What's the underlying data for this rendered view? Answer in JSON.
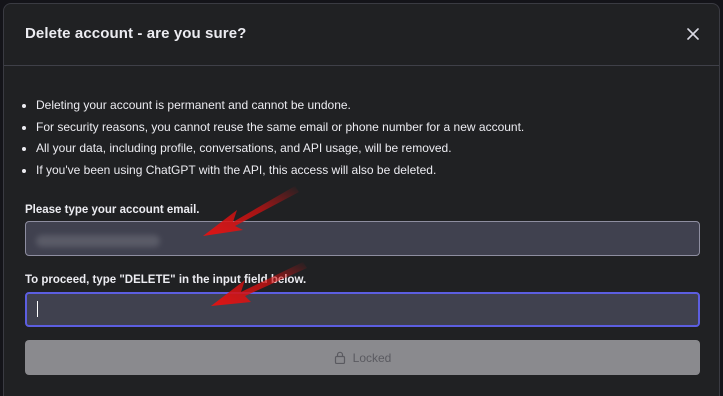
{
  "dialog": {
    "title": "Delete account - are you sure?",
    "close_icon": "close-icon"
  },
  "warnings": [
    "Deleting your account is permanent and cannot be undone.",
    "For security reasons, you cannot reuse the same email or phone number for a new account.",
    "All your data, including profile, conversations, and API usage, will be removed.",
    "If you've been using ChatGPT with the API, this access will also be deleted."
  ],
  "email_field": {
    "label": "Please type your account email.",
    "value": ""
  },
  "confirm_field": {
    "label": "To proceed, type \"DELETE\" in the input field below.",
    "value": ""
  },
  "locked_button": {
    "label": "Locked",
    "icon": "lock-icon"
  },
  "colors": {
    "background": "#202123",
    "input_background": "#40414f",
    "focus_border": "#5c5ee0",
    "annotation_arrow": "#e01414",
    "locked_button": "#8a8a8e"
  }
}
